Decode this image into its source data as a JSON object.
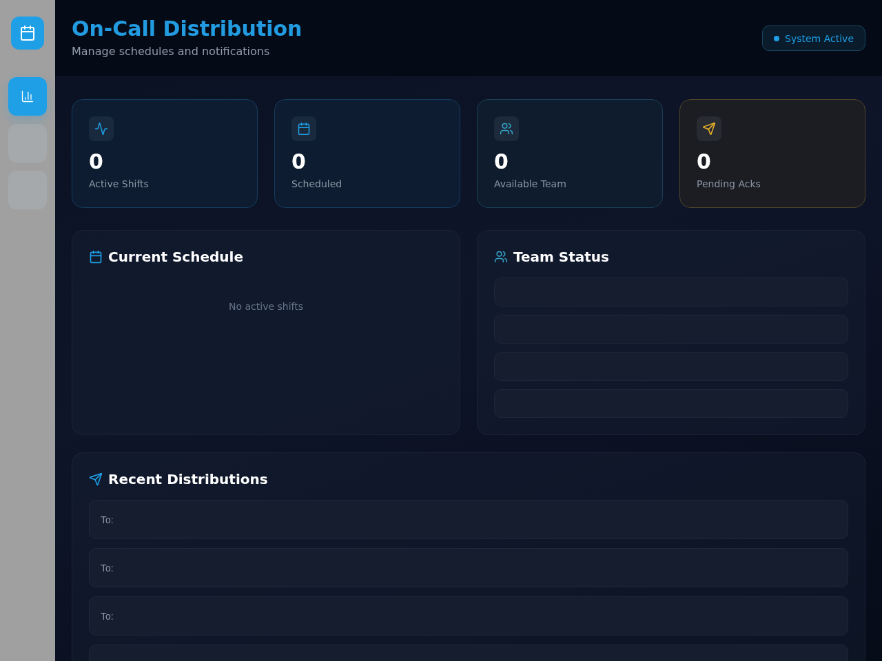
{
  "sidebar": {
    "nav_items": [
      {
        "selected": true
      },
      {
        "selected": false
      },
      {
        "selected": false
      }
    ]
  },
  "header": {
    "title": "On-Call Distribution",
    "subtitle": "Manage schedules and notifications",
    "status": {
      "label": "System Active"
    }
  },
  "stats": [
    {
      "value": "0",
      "label": "Active Shifts",
      "color": "#1e9fe6"
    },
    {
      "value": "0",
      "label": "Scheduled",
      "color": "#1e9fe6"
    },
    {
      "value": "0",
      "label": "Available Team",
      "color": "#35a6c8"
    },
    {
      "value": "0",
      "label": "Pending Acks",
      "color": "#f0b429"
    }
  ],
  "current_schedule": {
    "title": "Current Schedule",
    "empty_message": "No active shifts"
  },
  "team_status": {
    "title": "Team Status",
    "rows": [
      {
        "kind": "empty"
      },
      {
        "kind": "empty"
      },
      {
        "kind": "empty"
      },
      {
        "kind": "empty"
      }
    ]
  },
  "recent_distributions": {
    "title": "Recent Distributions",
    "rows": [
      {
        "kind": "entry",
        "to_label": "To:"
      },
      {
        "kind": "entry",
        "to_label": "To:"
      },
      {
        "kind": "entry",
        "to_label": "To:"
      },
      {
        "kind": "entry"
      }
    ]
  }
}
